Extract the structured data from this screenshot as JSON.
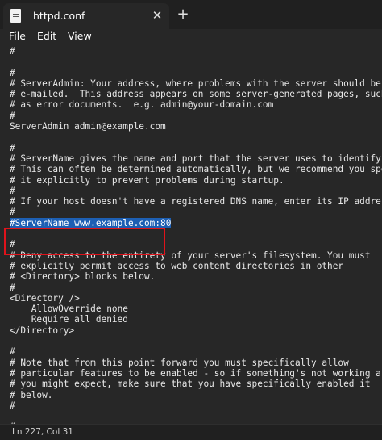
{
  "tab": {
    "icon": "notepad-icon",
    "title": "httpd.conf",
    "close_glyph": "✕",
    "new_tab_glyph": "+"
  },
  "menu": [
    "File",
    "Edit",
    "View"
  ],
  "editor_lines": [
    "#",
    "",
    "#",
    "# ServerAdmin: Your address, where problems with the server should be",
    "# e-mailed.  This address appears on some server-generated pages, such",
    "# as error documents.  e.g. admin@your-domain.com",
    "#",
    "ServerAdmin admin@example.com",
    "",
    "#",
    "# ServerName gives the name and port that the server uses to identify itself.",
    "# This can often be determined automatically, but we recommend you specify",
    "# it explicitly to prevent problems during startup.",
    "#",
    "# If your host doesn't have a registered DNS name, enter its IP address here.",
    "#",
    "#ServerName www.example.com:80",
    "",
    "#",
    "# Deny access to the entirety of your server's filesystem. You must",
    "# explicitly permit access to web content directories in other",
    "# <Directory> blocks below.",
    "#",
    "<Directory />",
    "    AllowOverride none",
    "    Require all denied",
    "</Directory>",
    "",
    "#",
    "# Note that from this point forward you must specifically allow",
    "# particular features to be enabled - so if something's not working as",
    "# you might expect, make sure that you have specifically enabled it",
    "# below.",
    "#",
    "",
    "#"
  ],
  "selected_line_index": 16,
  "highlight_color": "#e0131b",
  "selection_color": "#1d5fb3",
  "status": {
    "position": "Ln 227, Col 31"
  }
}
